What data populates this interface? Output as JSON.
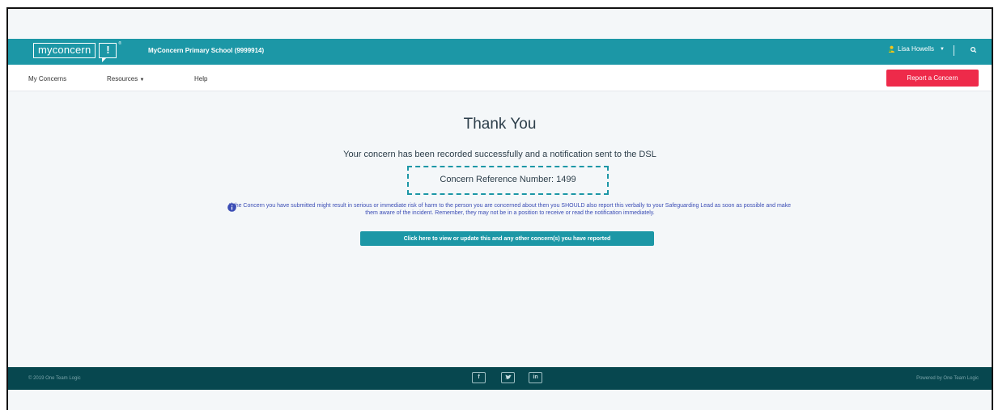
{
  "topbar": {
    "logo_word": "myconcern",
    "logo_mark": "!",
    "logo_tm": "®",
    "school_name": "MyConcern Primary School (9999914)",
    "user_name": "Lisa Howells",
    "user_icon": "user-icon",
    "search_icon": "search-icon",
    "accent_color": "#1c97a6"
  },
  "nav": {
    "my_concerns": "My Concerns",
    "resources": "Resources",
    "help": "Help",
    "report_button": "Report a Concern",
    "report_color": "#ee2a4a"
  },
  "main": {
    "title": "Thank You",
    "subtitle": "Your concern has been recorded successfully and a notification sent to the DSL",
    "reference": "Concern Reference Number: 1499",
    "info_icon": "info-icon",
    "info_text": "If the Concern you have submitted might result in serious or immediate risk of harm to the person you are concerned about then you SHOULD also report this verbally to your Safeguarding Lead as soon as possible and make them aware of the incident. Remember, they may not be in a position to receive or read the notification immediately.",
    "view_button": "Click here to view or update this and any other concern(s) you have reported"
  },
  "footer": {
    "copyright": "© 2019 One Team Logic",
    "powered_by": "Powered by One Team Logic",
    "facebook": "f",
    "twitter": "t",
    "linkedin": "in",
    "footer_color": "#07474f"
  }
}
